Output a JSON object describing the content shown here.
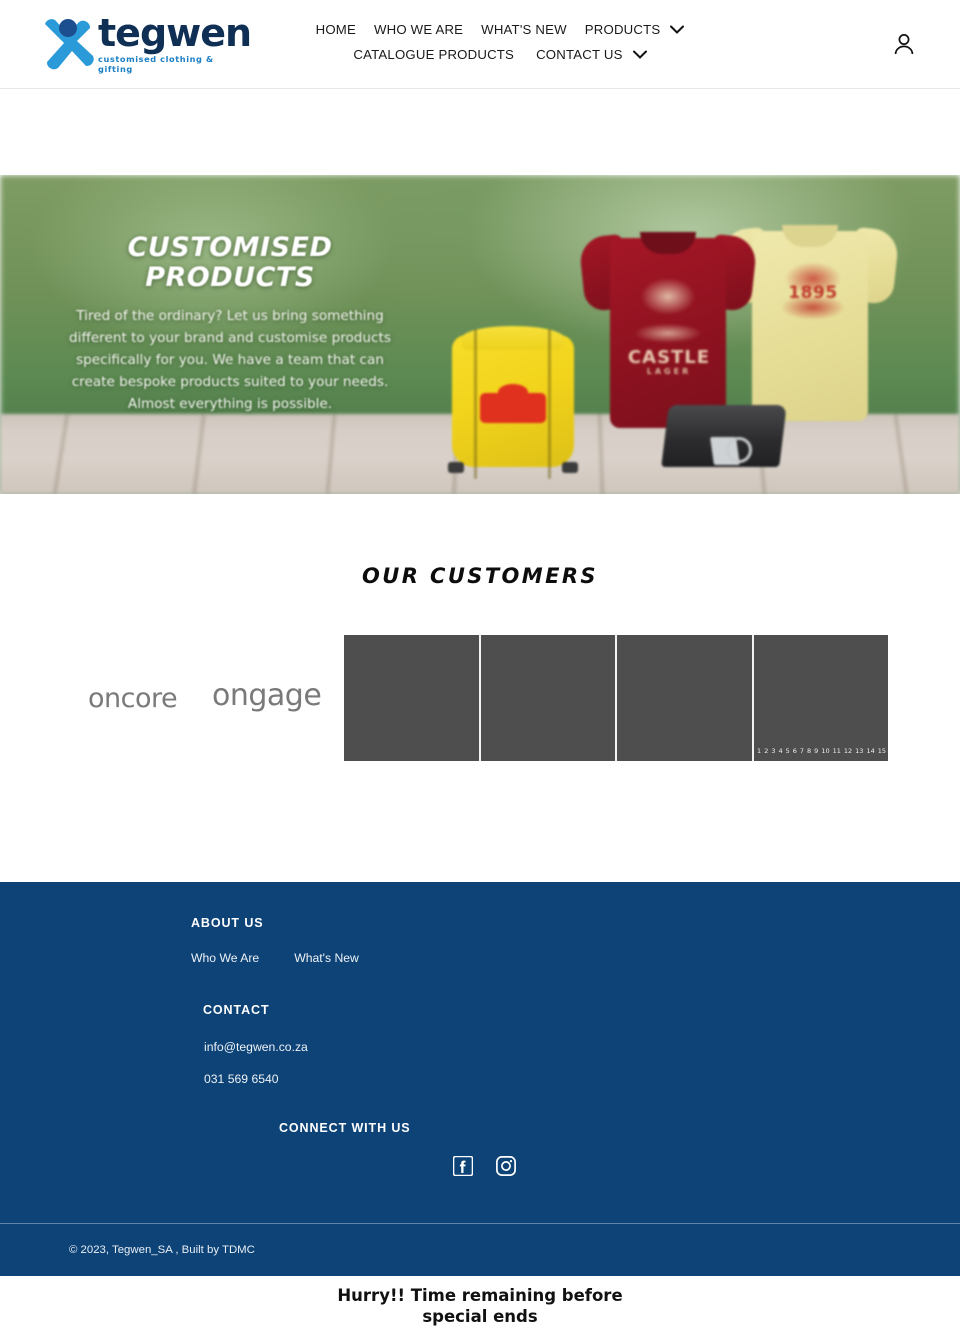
{
  "header": {
    "logo": {
      "word": "tegwen",
      "tagline": "customised clothing & gifting",
      "mark_icon": "x-logo-icon",
      "brand_blue": "#1b7fc4",
      "brand_navy": "#0f2f55"
    },
    "nav_row1": [
      {
        "label": "HOME",
        "has_chevron": false
      },
      {
        "label": "WHO WE ARE",
        "has_chevron": false
      },
      {
        "label": "WHAT'S NEW",
        "has_chevron": false
      },
      {
        "label": "PRODUCTS",
        "has_chevron": true
      }
    ],
    "nav_row2": [
      {
        "label": "CATALOGUE PRODUCTS",
        "has_chevron": false
      },
      {
        "label": "CONTACT US",
        "has_chevron": true
      }
    ],
    "account_icon": "user-account-icon"
  },
  "hero": {
    "title": "CUSTOMISED PRODUCTS",
    "body": "Tired of the ordinary? Let us bring something different to your brand and customise products specifically for you. We have a team that can create bespoke products suited to your needs. Almost everything is possible.",
    "products": {
      "bag_label": "yellow drawstring bag",
      "tee_red_print_word": "CASTLE",
      "tee_red_print_sub": "LAGER",
      "tee_cream_print_word": "1895",
      "phone_case_label": "black phone case with ring stand"
    }
  },
  "customers": {
    "title": "OUR CUSTOMERS",
    "brands": [
      {
        "name": "oncore"
      },
      {
        "name": "ongage"
      }
    ],
    "placeholder_count": 4,
    "pager": [
      "1",
      "2",
      "3",
      "4",
      "5",
      "6",
      "7",
      "8",
      "9",
      "10",
      "11",
      "12",
      "13",
      "14",
      "15"
    ]
  },
  "footer": {
    "background": "#0d4377",
    "about_heading": "ABOUT US",
    "about_links": [
      {
        "label": "Who We Are"
      },
      {
        "label": "What's New"
      }
    ],
    "contact_heading": "CONTACT",
    "email": "info@tegwen.co.za",
    "phone": "031 569 6540",
    "connect_heading": "CONNECT WITH US",
    "socials": [
      {
        "name": "facebook-icon"
      },
      {
        "name": "instagram-icon"
      }
    ],
    "copyright": "© 2023, Tegwen_SA , Built by TDMC"
  },
  "promo": {
    "line1": "Hurry!! Time remaining before",
    "line2": "special ends"
  }
}
